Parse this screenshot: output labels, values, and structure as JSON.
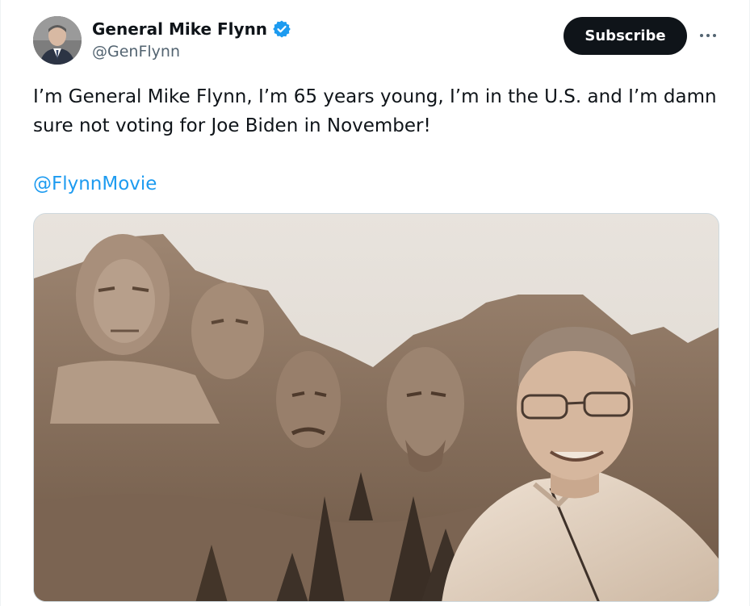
{
  "tweet": {
    "author": {
      "display_name": "General Mike Flynn",
      "handle": "@GenFlynn",
      "verified": true,
      "verified_icon": "verified-badge-icon"
    },
    "subscribe_label": "Subscribe",
    "more_icon": "more-options-icon",
    "text_line_1": "I’m General Mike Flynn, I’m 65 years young, I’m in the U.S. and I’m damn",
    "text_line_2": "sure not voting for Joe Biden in November!",
    "mention": "@FlynnMovie",
    "media_image": "photo-mount-rushmore-with-man"
  },
  "colors": {
    "text_primary": "#0f1419",
    "text_secondary": "#536471",
    "link": "#1d9bf0",
    "button_bg": "#0f1419",
    "verified": "#1d9bf0"
  }
}
